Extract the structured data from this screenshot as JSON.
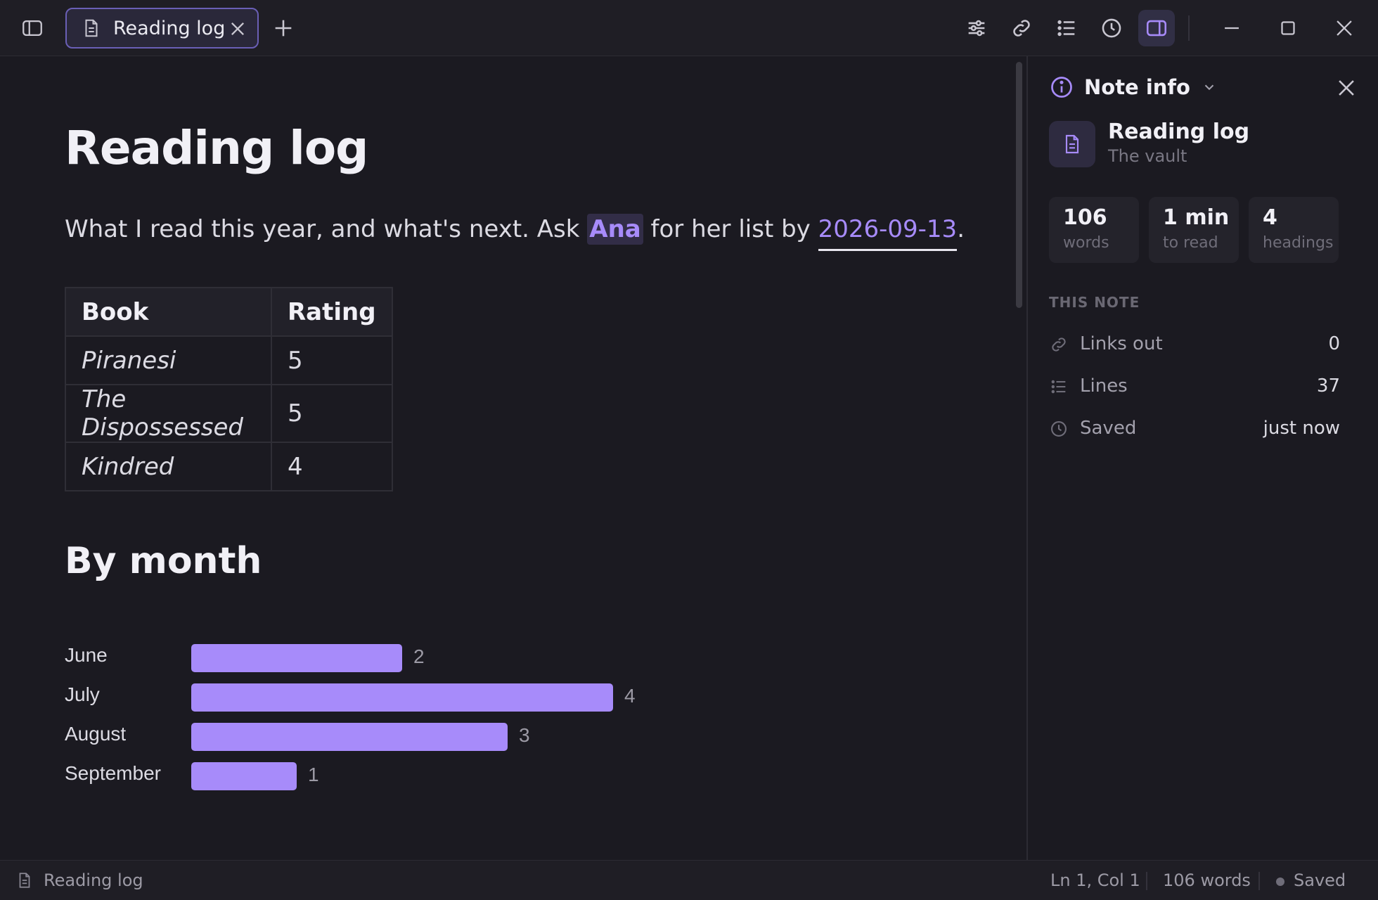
{
  "tab": {
    "label": "Reading log"
  },
  "toolbar_icons": [
    "sidebar-toggle-icon",
    "sliders-icon",
    "link-icon",
    "outline-list-icon",
    "history-clock-icon",
    "right-panel-icon",
    "minimize-icon",
    "maximize-icon",
    "close-icon"
  ],
  "note": {
    "title": "Reading log",
    "intro_pre": "What I read this year, and what's next. Ask ",
    "mention": "Ana",
    "intro_mid": " for her list by ",
    "date_link": "2026-09-13",
    "intro_post": ".",
    "table": {
      "headers": [
        "Book",
        "Rating"
      ],
      "rows": [
        [
          "Piranesi",
          "5"
        ],
        [
          "The Dispossessed",
          "5"
        ],
        [
          "Kindred",
          "4"
        ]
      ]
    },
    "section_heading": "By month"
  },
  "chart_data": {
    "type": "bar",
    "orientation": "horizontal",
    "categories": [
      "June",
      "July",
      "August",
      "September"
    ],
    "values": [
      2,
      4,
      3,
      1
    ],
    "xlim": [
      0,
      4
    ],
    "grid": false,
    "color": "#a78bfa"
  },
  "panel": {
    "title": "Note info",
    "note_name": "Reading log",
    "vault": "The vault",
    "stats": [
      {
        "num": "106",
        "label": "words"
      },
      {
        "num": "1 min",
        "label": "to read"
      },
      {
        "num": "4",
        "label": "headings"
      }
    ],
    "section": "THIS NOTE",
    "props": [
      {
        "icon": "link-icon",
        "label": "Links out",
        "value": "0"
      },
      {
        "icon": "list-icon",
        "label": "Lines",
        "value": "37"
      },
      {
        "icon": "clock-icon",
        "label": "Saved",
        "value": "just now"
      }
    ]
  },
  "statusbar": {
    "file": "Reading log",
    "cursor": "Ln 1, Col 1",
    "words": "106 words",
    "state": "Saved"
  },
  "colors": {
    "accent": "#a78bfa",
    "background": "#1b1a21",
    "titlebar": "#1f1e25"
  }
}
